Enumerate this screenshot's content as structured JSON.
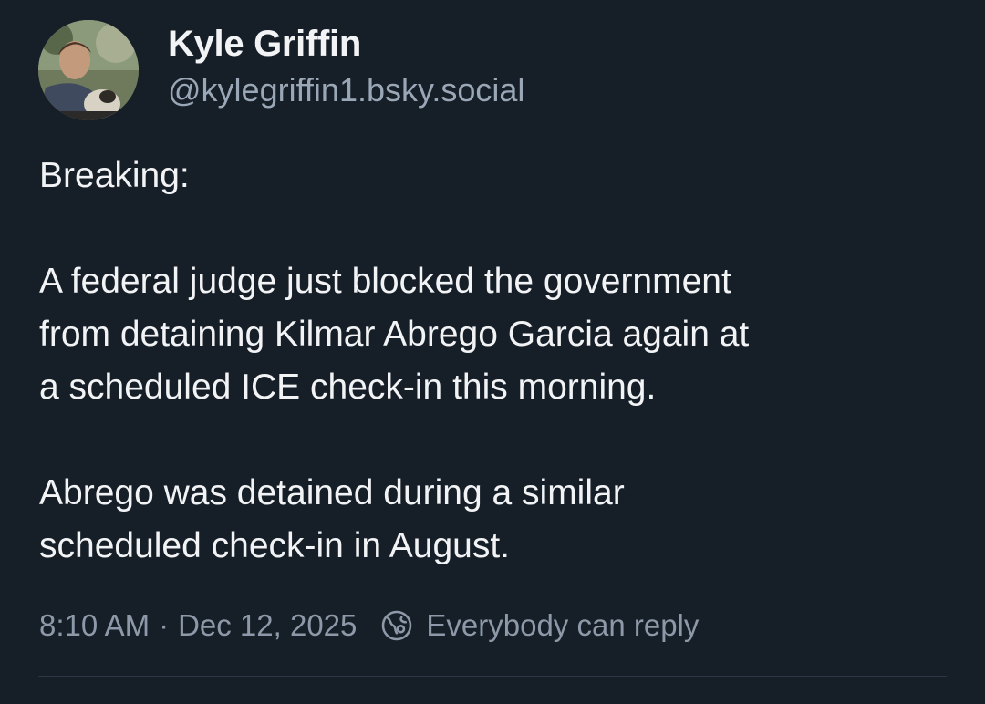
{
  "post": {
    "author": {
      "display_name": "Kyle Griffin",
      "handle": "@kylegriffin1.bsky.social"
    },
    "paragraphs": [
      "Breaking:",
      "A federal judge just blocked the government\nfrom detaining Kilmar Abrego Garcia again at\na scheduled ICE check-in this morning.",
      "Abrego was detained during a similar\nscheduled check-in in August."
    ],
    "time": "8:10 AM",
    "separator": "·",
    "date": "Dec 12, 2025",
    "reply_setting": {
      "icon": "globe-icon",
      "label": "Everybody can reply"
    }
  },
  "colors": {
    "background": "#161e27",
    "text": "#f1f3f5",
    "secondary_text": "#9aa7b6",
    "divider": "#2b3645"
  }
}
